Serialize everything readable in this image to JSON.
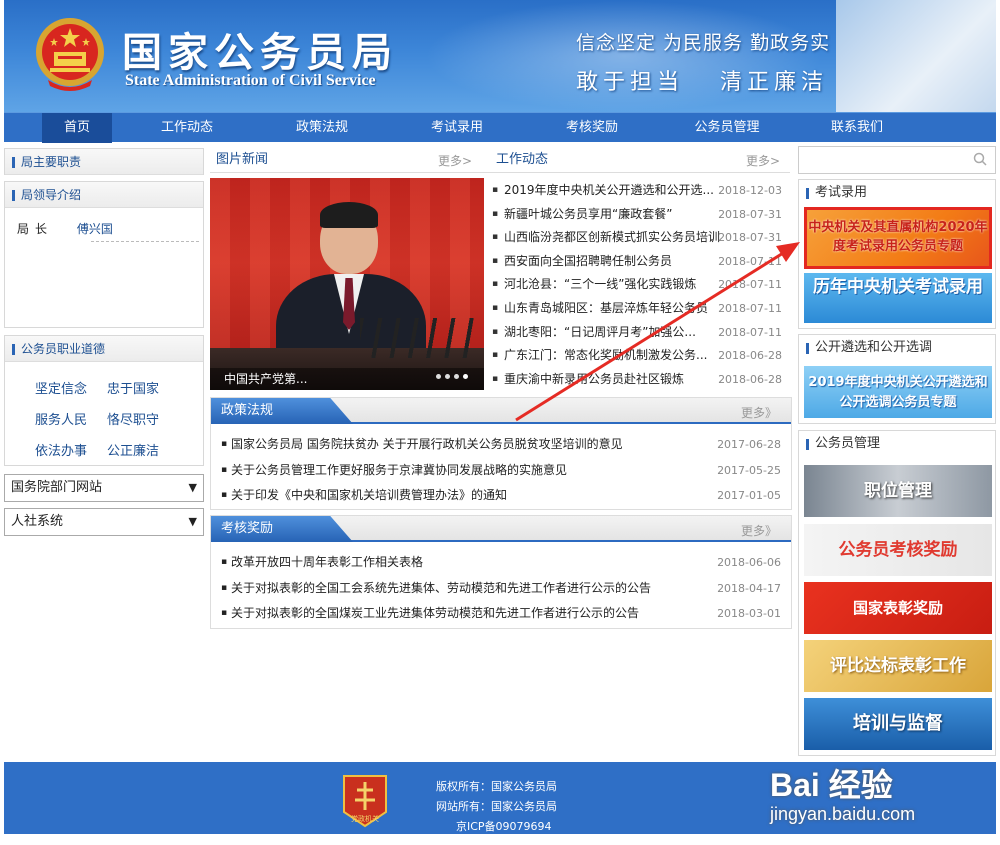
{
  "header": {
    "title": "国家公务员局",
    "subtitle": "State Administration of Civil Service",
    "slogan_1": "信念坚定 为民服务 勤政务实",
    "slogan_2": "敢于担当   清正廉洁",
    "colors": {
      "header_blue": "#2a6fc7",
      "nav_blue": "#2f6fc6",
      "nav_active": "#1a4d9a"
    }
  },
  "nav": {
    "items": [
      {
        "label": "首页",
        "active": true
      },
      {
        "label": "工作动态"
      },
      {
        "label": "政策法规"
      },
      {
        "label": "考试录用"
      },
      {
        "label": "考核奖励"
      },
      {
        "label": "公务员管理"
      },
      {
        "label": "联系我们"
      }
    ]
  },
  "left": {
    "duty_title": "局主要职责",
    "leaders_title": "局领导介绍",
    "leader_role": "局长",
    "leader_name": "傅兴国",
    "ethics_title": "公务员职业道德",
    "ethics": [
      "坚定信念",
      "忠于国家",
      "服务人民",
      "恪尽职守",
      "依法办事",
      "公正廉洁"
    ],
    "select_1": "国务院部门网站",
    "select_2": "人社系统"
  },
  "center": {
    "photo_news_title": "图片新闻",
    "more_label": "更多>",
    "photo_caption": "中国共产党第...",
    "work_title": "工作动态",
    "work_news": [
      {
        "title": "2019年度中央机关公开遴选和公开选...",
        "date": "2018-12-03"
      },
      {
        "title": "新疆叶城公务员享用“廉政套餐”",
        "date": "2018-07-31"
      },
      {
        "title": "山西临汾尧都区创新模式抓实公务员培训",
        "date": "2018-07-31"
      },
      {
        "title": "西安面向全国招聘聘任制公务员",
        "date": "2018-07-11"
      },
      {
        "title": "河北沧县：“三个一线”强化实践锻炼",
        "date": "2018-07-11"
      },
      {
        "title": "山东青岛城阳区：基层淬炼年轻公务员",
        "date": "2018-07-11"
      },
      {
        "title": "湖北枣阳：“日记周评月考”加强公...",
        "date": "2018-07-11"
      },
      {
        "title": "广东江门：常态化奖励机制激发公务...",
        "date": "2018-06-28"
      },
      {
        "title": "重庆渝中新录用公务员赴社区锻炼",
        "date": "2018-06-28"
      }
    ],
    "policy_title": "政策法规",
    "policy_more": "更多》",
    "policy_items": [
      {
        "title": "国家公务员局 国务院扶贫办 关于开展行政机关公务员脱贫攻坚培训的意见",
        "date": "2017-06-28"
      },
      {
        "title": "关于公务员管理工作更好服务于京津冀协同发展战略的实施意见",
        "date": "2017-05-25"
      },
      {
        "title": "关于印发《中央和国家机关培训费管理办法》的通知",
        "date": "2017-01-05"
      }
    ],
    "reward_title": "考核奖励",
    "reward_more": "更多》",
    "reward_items": [
      {
        "title": "改革开放四十周年表彰工作相关表格",
        "date": "2018-06-06"
      },
      {
        "title": "关于对拟表彰的全国工会系统先进集体、劳动模范和先进工作者进行公示的公告",
        "date": "2018-04-17"
      },
      {
        "title": "关于对拟表彰的全国煤炭工业先进集体劳动模范和先进工作者进行公示的公告",
        "date": "2018-03-01"
      }
    ]
  },
  "right": {
    "exam_title": "考试录用",
    "banner_2020": "中央机关及其直属机构2020年度考试录用公务员专题",
    "banner_hist": "历年中央机关考试录用",
    "select_title": "公开遴选和公开选调",
    "banner_select": "2019年度中央机关公开遴选和公开选调公务员专题",
    "manage_title": "公务员管理",
    "banner_post": "职位管理",
    "banner_assess": "公务员考核奖励",
    "banner_award": "国家表彰奖励",
    "banner_eval": "评比达标表彰工作",
    "banner_train": "培训与监督"
  },
  "footer": {
    "copyright": "版权所有：国家公务员局",
    "site": "网站所有：国家公务员局",
    "icp": "京ICP备09079694",
    "badge_text": "党政机关"
  },
  "watermark": {
    "brand": "Bai 经验",
    "url": "jingyan.baidu.com"
  }
}
